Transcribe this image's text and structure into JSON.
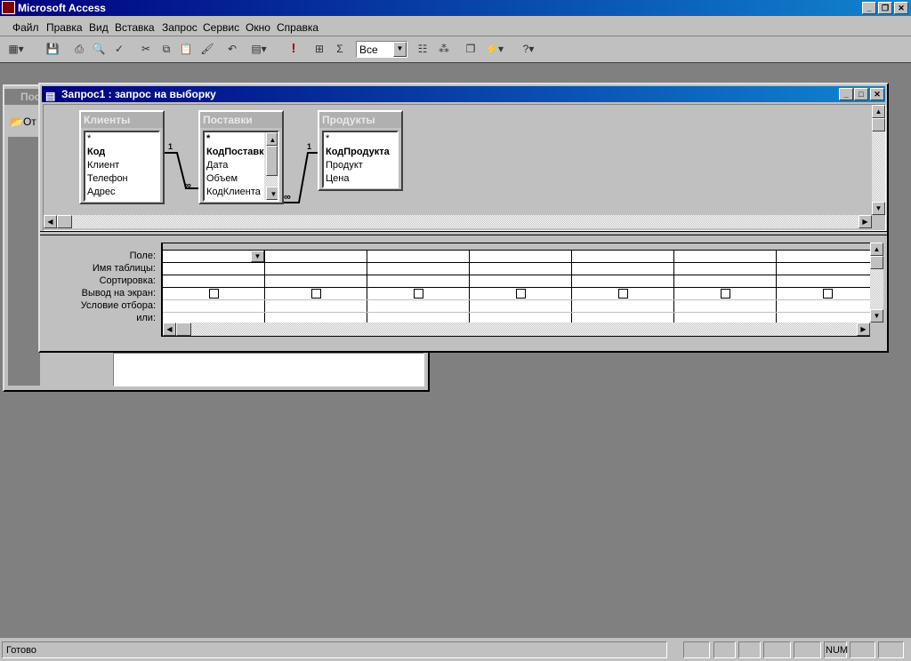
{
  "app": {
    "title": "Microsoft Access"
  },
  "menu": [
    "Файл",
    "Правка",
    "Вид",
    "Вставка",
    "Запрос",
    "Сервис",
    "Окно",
    "Справка"
  ],
  "toolbar": {
    "top_values": "Все"
  },
  "db_window": {
    "title": "Поставки",
    "open_label": "От"
  },
  "query_window": {
    "title": "Запрос1 : запрос на выборку"
  },
  "tables": [
    {
      "name": "Клиенты",
      "fields": [
        "*",
        "Код",
        "Клиент",
        "Телефон",
        "Адрес"
      ],
      "key": "Код"
    },
    {
      "name": "Поставки",
      "fields": [
        "*",
        "КодПоставки",
        "Дата",
        "Объем",
        "КодКлиента"
      ],
      "key": "КодПоставки"
    },
    {
      "name": "Продукты",
      "fields": [
        "*",
        "КодПродукта",
        "Продукт",
        "Цена"
      ],
      "key": "КодПродукта"
    }
  ],
  "relations": {
    "one": "1",
    "many": "∞"
  },
  "grid": {
    "row_labels": [
      "Поле:",
      "Имя таблицы:",
      "Сортировка:",
      "Вывод на экран:",
      "Условие отбора:",
      "или:"
    ],
    "columns": 7
  },
  "status": {
    "text": "Готово",
    "num": "NUM"
  }
}
